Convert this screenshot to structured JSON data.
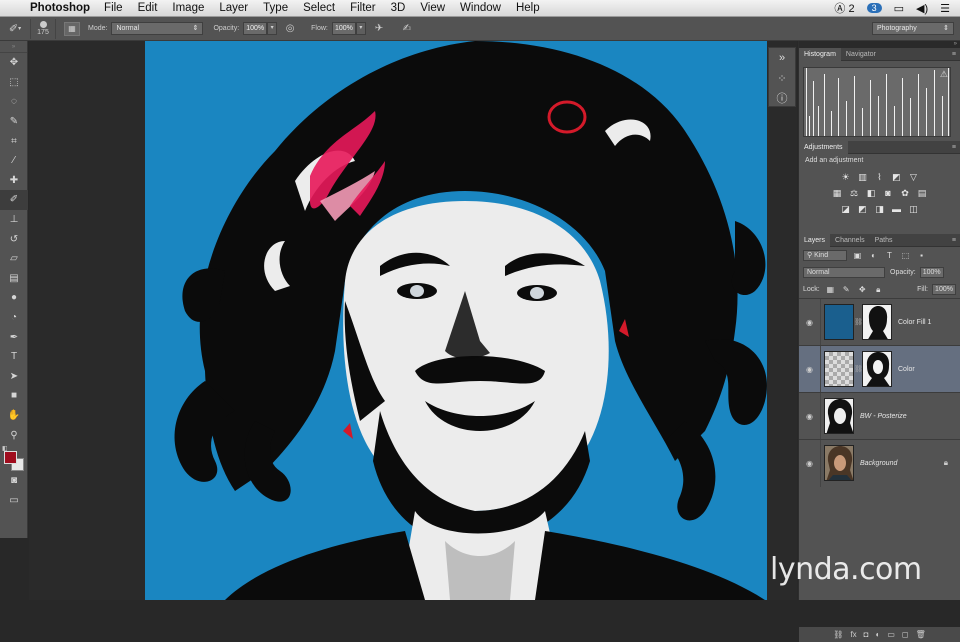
{
  "menubar": {
    "app_name": "Photoshop",
    "items": [
      "File",
      "Edit",
      "Image",
      "Layer",
      "Type",
      "Select",
      "Filter",
      "3D",
      "View",
      "Window",
      "Help"
    ],
    "status_adobe": "2",
    "status_cc": "3"
  },
  "options": {
    "brush_size": "175",
    "mode_label": "Mode:",
    "mode_value": "Normal",
    "opacity_label": "Opacity:",
    "opacity_value": "100%",
    "flow_label": "Flow:",
    "flow_value": "100%",
    "workspace": "Photography"
  },
  "tools": {
    "items": [
      {
        "name": "move-tool",
        "glyph": "✥"
      },
      {
        "name": "marquee-tool",
        "glyph": "⬚"
      },
      {
        "name": "lasso-tool",
        "glyph": "◌"
      },
      {
        "name": "quick-select-tool",
        "glyph": "✎"
      },
      {
        "name": "crop-tool",
        "glyph": "⌗"
      },
      {
        "name": "eyedropper-tool",
        "glyph": "⁄"
      },
      {
        "name": "healing-brush-tool",
        "glyph": "✚"
      },
      {
        "name": "brush-tool",
        "glyph": "✐"
      },
      {
        "name": "clone-stamp-tool",
        "glyph": "⊥"
      },
      {
        "name": "history-brush-tool",
        "glyph": "↺"
      },
      {
        "name": "eraser-tool",
        "glyph": "▱"
      },
      {
        "name": "gradient-tool",
        "glyph": "▤"
      },
      {
        "name": "blur-tool",
        "glyph": "●"
      },
      {
        "name": "dodge-tool",
        "glyph": "◔"
      },
      {
        "name": "pen-tool",
        "glyph": "✒"
      },
      {
        "name": "type-tool",
        "glyph": "T"
      },
      {
        "name": "path-select-tool",
        "glyph": "➤"
      },
      {
        "name": "shape-tool",
        "glyph": "■"
      },
      {
        "name": "hand-tool",
        "glyph": "✋"
      },
      {
        "name": "zoom-tool",
        "glyph": "⚲"
      }
    ],
    "active_index": 7,
    "foreground_color": "#a00d1e",
    "background_color": "#e8e8e8"
  },
  "panels": {
    "histogram_tab": "Histogram",
    "navigator_tab": "Navigator",
    "adjustments_tab": "Adjustments",
    "adjustments_title": "Add an adjustment",
    "layers_tab": "Layers",
    "channels_tab": "Channels",
    "paths_tab": "Paths",
    "filter_kind": "Kind",
    "blend_mode": "Normal",
    "opacity_label": "Opacity:",
    "opacity_value": "100%",
    "lock_label": "Lock:",
    "fill_label": "Fill:",
    "fill_value": "100%"
  },
  "layers": [
    {
      "name": "Color Fill 1",
      "type": "fill",
      "thumb_color": "#1a5f8e",
      "selected": false,
      "italic": false
    },
    {
      "name": "Color",
      "type": "transparent",
      "selected": true,
      "italic": false
    },
    {
      "name": "BW - Posterize",
      "type": "photo-bw",
      "selected": false,
      "italic": true
    },
    {
      "name": "Background",
      "type": "photo-color",
      "selected": false,
      "italic": true,
      "locked": true
    }
  ],
  "colors": {
    "canvas_bg": "#1a86c1",
    "ink": "#0b0b0b",
    "highlight": "#ececec",
    "accent_red": "#e8185a"
  },
  "watermark": "lynda.com"
}
